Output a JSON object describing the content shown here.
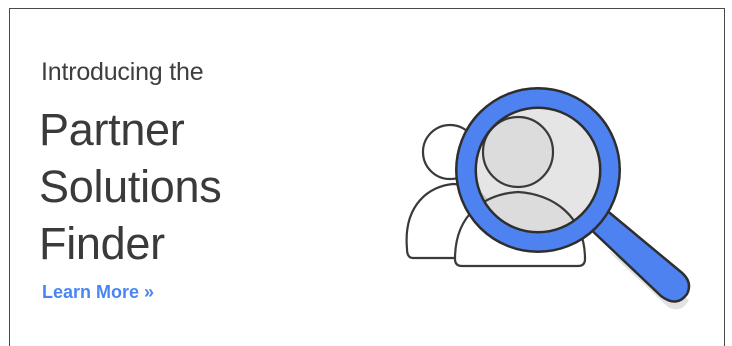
{
  "banner": {
    "intro": "Introducing the",
    "headline_lines": [
      "Partner",
      "Solutions",
      "Finder"
    ],
    "cta_label": "Learn More »"
  },
  "illustration": {
    "icon": "magnifier-people-icon",
    "accent_color": "#4d82f0"
  },
  "colors": {
    "text": "#3a3a3a",
    "link": "#4a86f3",
    "border": "#4a4a4a"
  }
}
